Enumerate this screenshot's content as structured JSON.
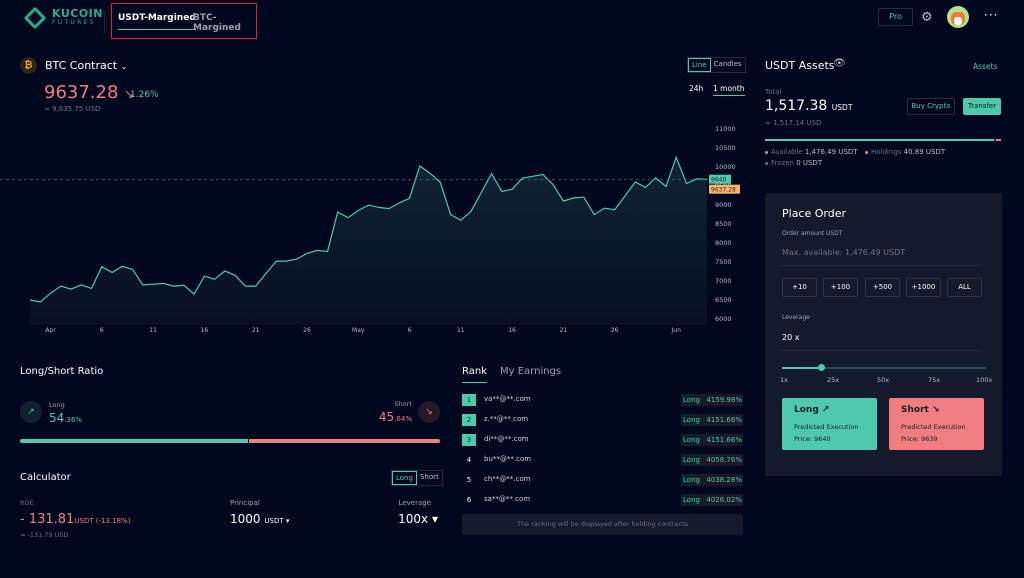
{
  "header": {
    "logo_line1": "KUCOIN",
    "logo_line2": "FUTURES",
    "tabs": [
      "USDT-Margined",
      "BTC-Margined"
    ],
    "pro_label": "Pro",
    "more_label": "···"
  },
  "contract": {
    "icon": "₿",
    "name": "BTC Contract",
    "price": "9637.28",
    "arrow": "↘",
    "change_pct": "1.26%",
    "price_usd": "≈ 9,635.75 USD",
    "chart_types": [
      "Line",
      "Candles"
    ],
    "ranges": [
      "24h",
      "1 month"
    ]
  },
  "chart_data": {
    "type": "line",
    "title": "BTC Contract",
    "x_start": "Mar 30",
    "x_unit": "day",
    "values": [
      6473,
      6420,
      6650,
      6840,
      6760,
      6870,
      6780,
      7350,
      7200,
      7360,
      7280,
      6870,
      6890,
      6910,
      6840,
      6860,
      6630,
      7100,
      7020,
      7240,
      7120,
      6840,
      6840,
      7170,
      7490,
      7500,
      7550,
      7700,
      7780,
      7750,
      8790,
      8640,
      8830,
      8970,
      8910,
      8880,
      9030,
      9150,
      10000,
      9810,
      9570,
      8720,
      8570,
      8810,
      9300,
      9800,
      9330,
      9390,
      9680,
      9730,
      9780,
      9510,
      9080,
      9160,
      9180,
      8720,
      8890,
      8850,
      9210,
      9580,
      9440,
      9690,
      9460,
      10230,
      9540,
      9660,
      9650
    ],
    "ylim": [
      6000,
      11000
    ],
    "yticks": [
      "6000",
      "6500",
      "7000",
      "7500",
      "8000",
      "8500",
      "9000",
      "9500",
      "10000",
      "10500",
      "11000"
    ],
    "xticks": [
      {
        "day": 2,
        "label": "Apr"
      },
      {
        "day": 7,
        "label": "6"
      },
      {
        "day": 12,
        "label": "11"
      },
      {
        "day": 17,
        "label": "16"
      },
      {
        "day": 22,
        "label": "21"
      },
      {
        "day": 27,
        "label": "26"
      },
      {
        "day": 32,
        "label": "May"
      },
      {
        "day": 37,
        "label": "6"
      },
      {
        "day": 42,
        "label": "11"
      },
      {
        "day": 47,
        "label": "16"
      },
      {
        "day": 52,
        "label": "21"
      },
      {
        "day": 57,
        "label": "26"
      },
      {
        "day": 63,
        "label": "Jun"
      }
    ],
    "last_price_label": "9640",
    "mark_price_label": "9637.28",
    "last_price": 9640,
    "mark_price": 9637.28,
    "grid": false
  },
  "assets": {
    "title": "USDT Assets",
    "link": "Assets",
    "total_label": "Total",
    "total": "1,517.38",
    "total_unit": "USDT",
    "total_usd": "≈ 1,517.14 USD",
    "buy_label": "Buy Crypto",
    "transfer_label": "Transfer",
    "available_label": "Available",
    "available": "1,476.49 USDT",
    "holdings_label": "Holdings",
    "holdings": "40.89 USDT",
    "frozen_label": "Frozen",
    "frozen": "0 USDT",
    "available_fraction": 0.973
  },
  "order": {
    "title": "Place Order",
    "amount_label": "Order amount USDT",
    "amount_placeholder": "Max. available: 1,476.49 USDT",
    "quick": [
      "+10",
      "+100",
      "+500",
      "+1000",
      "ALL"
    ],
    "leverage_label": "Leverage",
    "leverage": "20 x",
    "leverage_value": 20,
    "leverage_max": 100,
    "slider_labels": [
      "1x",
      "25x",
      "50x",
      "75x",
      "100x"
    ],
    "long_label": "Long",
    "short_label": "Short",
    "predicted": "Predicted Execution",
    "long_price": "Price: 9640",
    "short_price": "Price: 9639",
    "long_color": "#4fc9ae",
    "short_color": "#f07d7f"
  },
  "ratio": {
    "title": "Long/Short Ratio",
    "long_label": "Long",
    "long_int": "54",
    "long_dec": ".36%",
    "short_label": "Short",
    "short_int": "45",
    "short_dec": ".64%",
    "long_percent": 54.36
  },
  "calculator": {
    "title": "Calculator",
    "tabs": [
      "Long",
      "Short"
    ],
    "roe_label": "ROE",
    "roe": "- 131.81",
    "roe_unit": "USDT (-13.18%)",
    "roe_usd": "≈ -131.79 USD",
    "principal_label": "Principal",
    "principal": "1000",
    "principal_unit": "USDT ▾",
    "leverage_label": "Leverage",
    "leverage": "100x ▾"
  },
  "rank": {
    "tabs": [
      "Rank",
      "My Earnings"
    ],
    "rows": [
      {
        "n": "1",
        "name": "va**@**.com",
        "side": "Long",
        "pct": "4159.98%"
      },
      {
        "n": "2",
        "name": "z.**@**.com",
        "side": "Long",
        "pct": "4151.66%"
      },
      {
        "n": "3",
        "name": "di**@**.com",
        "side": "Long",
        "pct": "4151.66%"
      },
      {
        "n": "4",
        "name": "bu**@**.com",
        "side": "Long",
        "pct": "4058.76%"
      },
      {
        "n": "5",
        "name": "ch**@**.com",
        "side": "Long",
        "pct": "4038.28%"
      },
      {
        "n": "6",
        "name": "sa**@**.com",
        "side": "Long",
        "pct": "4026.02%"
      }
    ],
    "note": "The ranking will be displayed after holding contracts"
  }
}
